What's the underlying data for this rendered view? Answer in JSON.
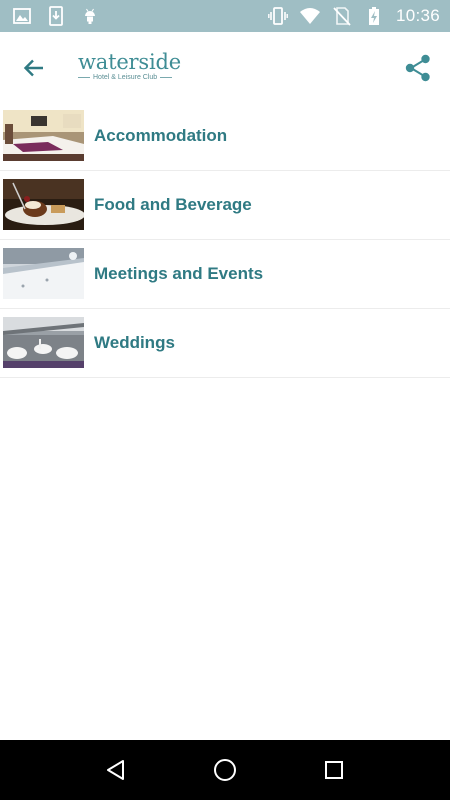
{
  "status_bar": {
    "time": "10:36",
    "left_icons": [
      "image-icon",
      "download-icon",
      "android-icon"
    ],
    "right_icons": [
      "vibrate-icon",
      "wifi-icon",
      "no-sim-icon",
      "battery-charging-icon"
    ]
  },
  "app_bar": {
    "logo_title": "waterside",
    "logo_subtitle": "Hotel & Leisure Club",
    "back_icon": "arrow-back-icon",
    "share_icon": "share-icon",
    "accent_color": "#3f8d95"
  },
  "menu": {
    "items": [
      {
        "label": "Accommodation",
        "thumbnail": "hotel-room-photo"
      },
      {
        "label": "Food and Beverage",
        "thumbnail": "dessert-plate-photo"
      },
      {
        "label": "Meetings and Events",
        "thumbnail": "conference-table-photo"
      },
      {
        "label": "Weddings",
        "thumbnail": "banquet-hall-photo"
      }
    ],
    "label_color": "#2f7a83"
  },
  "nav_bar": {
    "buttons": [
      "back-triangle-icon",
      "home-circle-icon",
      "recents-square-icon"
    ]
  }
}
